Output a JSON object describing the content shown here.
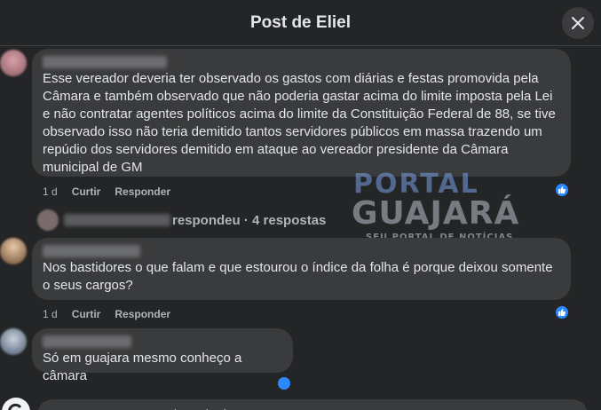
{
  "header": {
    "title": "Post de Eliel",
    "close_icon": "close-icon"
  },
  "comments": [
    {
      "text": "Esse vereador deveria ter observado os gastos com diárias e festas promovida pela Câmara e também observado que não poderia gastar acima do limite imposta pela Lei e não contratar agentes políticos acima do limite da Constituição Federal de 88, se tive observado isso não teria demitido tantos servidores públicos em massa trazendo um repúdio dos servidores demitido em ataque ao vereador presidente da Câmara municipal de GM",
      "time": "1 d",
      "like_label": "Curtir",
      "reply_label": "Responder"
    },
    {
      "text": "Nos bastidores o que falam e que estourou o índice da folha é porque deixou somente o seus cargos?",
      "time": "1 d",
      "like_label": "Curtir",
      "reply_label": "Responder"
    },
    {
      "text": "Só em guajara mesmo conheço a câmara"
    }
  ],
  "replies_summary": {
    "text": "respondeu · 4 respostas"
  },
  "watermark": {
    "line1": "PORTAL",
    "line2": "GUAJARÁ",
    "line3": "SEU PORTAL DE NOTÍCIAS"
  },
  "composer": {
    "placeholder": "Comente como Portal Guajará"
  },
  "colors": {
    "background": "#242526",
    "bubble": "#3a3b3c",
    "accent": "#2d88ff",
    "muted_text": "#b0b3b8"
  }
}
